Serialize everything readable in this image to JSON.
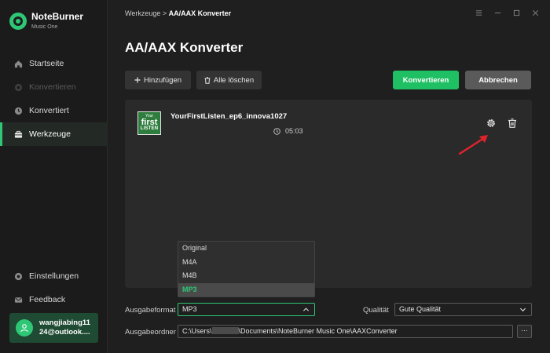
{
  "app": {
    "name": "NoteBurner",
    "subtitle": "Music One"
  },
  "sidebar": {
    "items": [
      {
        "label": "Startseite",
        "icon": "home-icon",
        "state": "normal"
      },
      {
        "label": "Konvertieren",
        "icon": "convert-icon",
        "state": "disabled"
      },
      {
        "label": "Konvertiert",
        "icon": "history-icon",
        "state": "normal"
      },
      {
        "label": "Werkzeuge",
        "icon": "toolbox-icon",
        "state": "active"
      }
    ],
    "bottom": [
      {
        "label": "Einstellungen",
        "icon": "gear-icon"
      },
      {
        "label": "Feedback",
        "icon": "mail-icon"
      }
    ],
    "user": {
      "line1": "wangjiabing11",
      "line2": "24@outlook...."
    }
  },
  "breadcrumb": {
    "parent": "Werkzeuge",
    "separator": ">",
    "current": "AA/AAX Konverter"
  },
  "page": {
    "title": "AA/AAX Konverter"
  },
  "toolbar": {
    "add_label": "Hinzufügen",
    "clear_label": "Alle löschen",
    "convert_label": "Konvertieren",
    "cancel_label": "Abbrechen"
  },
  "file": {
    "name": "YourFirstListen_ep6_innova1027",
    "duration": "05:03",
    "cover": {
      "line1": "Your",
      "line2": "first",
      "line3": "LISTEN"
    }
  },
  "output": {
    "format_label": "Ausgabeformat",
    "format_value": "MP3",
    "format_options": [
      "Original",
      "M4A",
      "M4B",
      "MP3"
    ],
    "selected_option": "MP3",
    "quality_label": "Qualität",
    "quality_value": "Gute Qualität",
    "folder_label": "Ausgabeordner",
    "folder_prefix": "C:\\Users\\",
    "folder_suffix": "\\Documents\\NoteBurner Music One\\AAXConverter",
    "more_label": "···"
  },
  "colors": {
    "accent": "#2ec776",
    "convert_button": "#1fbf64",
    "annotation_arrow": "#e0232b"
  }
}
